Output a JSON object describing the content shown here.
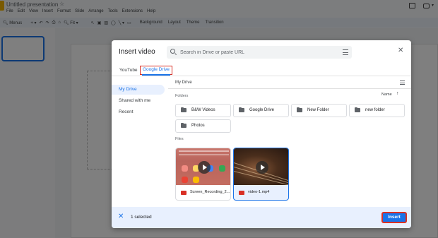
{
  "app": {
    "doc_title": "Untitled presentation",
    "menu": [
      "File",
      "Edit",
      "View",
      "Insert",
      "Format",
      "Slide",
      "Arrange",
      "Tools",
      "Extensions",
      "Help"
    ],
    "toolbar": {
      "menus": "Menus",
      "zoom": "Fit",
      "background": "Background",
      "layout": "Layout",
      "theme": "Theme",
      "transition": "Transition"
    }
  },
  "dialog": {
    "title": "Insert video",
    "search": {
      "placeholder": "Search in Drive or paste URL"
    },
    "tabs": [
      {
        "label": "YouTube",
        "active": false
      },
      {
        "label": "Google Drive",
        "active": true
      }
    ],
    "nav": [
      {
        "label": "My Drive",
        "selected": true
      },
      {
        "label": "Shared with me",
        "selected": false
      },
      {
        "label": "Recent",
        "selected": false
      }
    ],
    "breadcrumb": "My Drive",
    "folders_label": "Folders",
    "sort": {
      "label": "Name",
      "direction": "ascending"
    },
    "folders": [
      "B&W Videos",
      "Google Drive",
      "New Folder",
      "new folder",
      "Photos"
    ],
    "files_label": "Files",
    "files": [
      {
        "name": "Screen_Recording_2...",
        "selected": false
      },
      {
        "name": "video-1.mp4",
        "selected": true
      }
    ],
    "footer": {
      "selected_text": "1 selected",
      "insert_label": "Insert"
    }
  }
}
